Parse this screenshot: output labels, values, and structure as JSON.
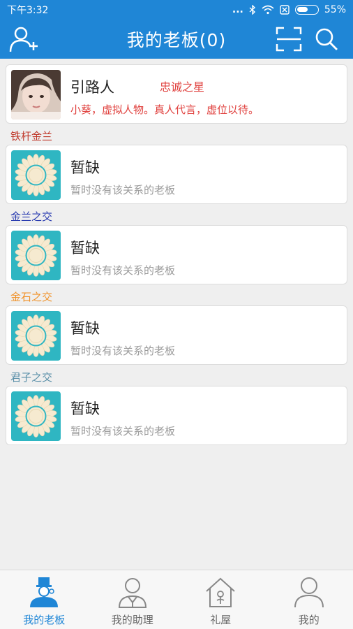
{
  "status_bar": {
    "time": "下午3:32",
    "dots": "...",
    "battery": "55%",
    "battery_level": 0.55
  },
  "header": {
    "title": "我的老板(0)",
    "add_icon": "add-user-icon",
    "scan_icon": "scan-icon",
    "search_icon": "search-icon"
  },
  "featured": {
    "name": "引路人",
    "badge": "忠诚之星",
    "description": "小葵，虚拟人物。真人代言，虚位以待。"
  },
  "sections": [
    {
      "label": "铁杆金兰",
      "label_color": "#c0392b",
      "name": "暂缺",
      "sub": "暂时没有该关系的老板"
    },
    {
      "label": "金兰之交",
      "label_color": "#2a3cb0",
      "name": "暂缺",
      "sub": "暂时没有该关系的老板"
    },
    {
      "label": "金石之交",
      "label_color": "#f0932b",
      "name": "暂缺",
      "sub": "暂时没有该关系的老板"
    },
    {
      "label": "君子之交",
      "label_color": "#5a8fa8",
      "name": "暂缺",
      "sub": "暂时没有该关系的老板"
    }
  ],
  "bottom_nav": [
    {
      "label": "我的老板",
      "icon": "boss-icon",
      "active": true
    },
    {
      "label": "我的助理",
      "icon": "assistant-icon",
      "active": false
    },
    {
      "label": "礼屋",
      "icon": "gift-house-icon",
      "active": false
    },
    {
      "label": "我的",
      "icon": "profile-icon",
      "active": false
    }
  ],
  "colors": {
    "brand": "#1f86d6",
    "accent_red": "#e0423f",
    "sunflower_bg": "#2fb6c2"
  }
}
